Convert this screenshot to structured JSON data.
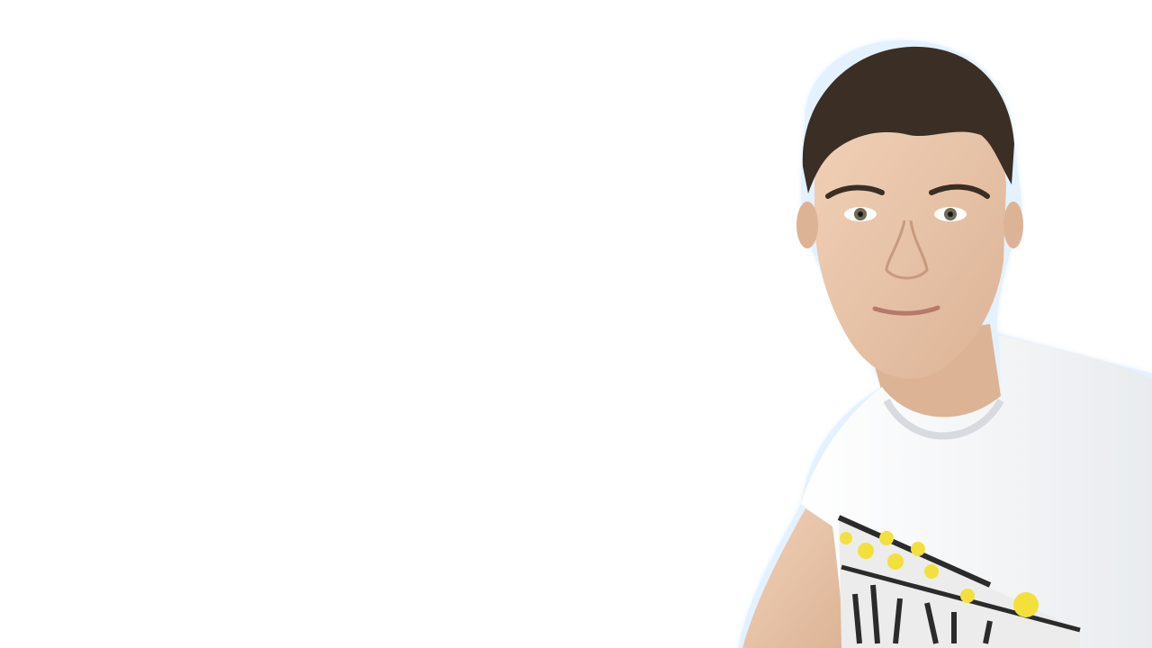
{
  "scene": {
    "background_color": "#ffffff",
    "subject": "person-cutout",
    "colors": {
      "hair": "#3a2e25",
      "skin": "#e9c7ad",
      "shirt": "#f5f6f8",
      "print_yellow": "#f3e03b",
      "print_dark": "#2b2b2b",
      "edge_glow": "#cfe6ff"
    }
  }
}
